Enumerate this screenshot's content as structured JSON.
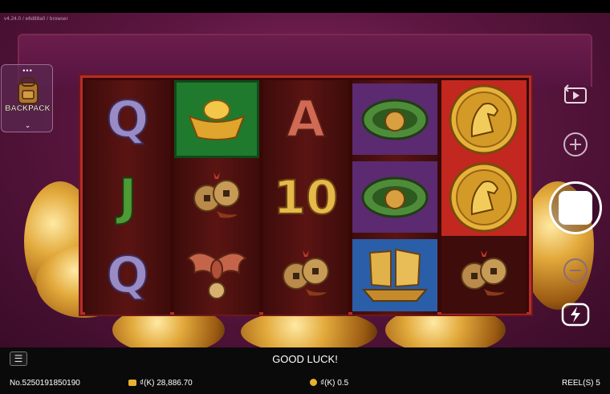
{
  "version": "v4.24.0 / e6d88a0 / browser",
  "backpack": {
    "label": "BACKPACK",
    "dots": "•••"
  },
  "reels": [
    {
      "cells": [
        {
          "symbol": "Q",
          "kind": "letter-q",
          "bg": ""
        },
        {
          "symbol": "J",
          "kind": "letter-j",
          "bg": ""
        },
        {
          "symbol": "Q",
          "kind": "letter-q",
          "bg": ""
        }
      ]
    },
    {
      "cells": [
        {
          "icon": "gold-ingot-icon",
          "bg": "bg-green"
        },
        {
          "icon": "chinese-coins-icon",
          "bg": ""
        },
        {
          "icon": "bat-icon",
          "bg": ""
        }
      ]
    },
    {
      "cells": [
        {
          "symbol": "A",
          "kind": "letter-a",
          "bg": ""
        },
        {
          "symbol": "10",
          "kind": "letter-10",
          "bg": ""
        },
        {
          "icon": "chinese-coins-icon",
          "bg": ""
        }
      ]
    },
    {
      "cells": [
        {
          "icon": "jade-ring-icon",
          "bg": "bg-purple"
        },
        {
          "icon": "jade-ring-icon",
          "bg": "bg-purple"
        },
        {
          "icon": "junk-ship-icon",
          "bg": "bg-blue"
        }
      ]
    },
    {
      "cells": [
        {
          "icon": "horse-coin-icon",
          "bg": "bg-red"
        },
        {
          "icon": "horse-coin-icon",
          "bg": "bg-red"
        },
        {
          "icon": "chinese-coins-icon",
          "bg": ""
        }
      ]
    }
  ],
  "colors": {
    "reel_border": "#b52d2a",
    "background": "#5c1640",
    "green_tile": "#1f7a2e",
    "red_tile": "#c2281f",
    "blue_tile": "#2a5ea8"
  },
  "status": {
    "message": "GOOD LUCK!",
    "ticket": "No.5250191850190",
    "balance": "₫(K) 28,886.70",
    "bet": "₫(K) 0.5",
    "reels": "REEL(S) 5"
  },
  "controls": {
    "autoplay_icon": "autoplay-icon",
    "bet_up_icon": "plus-icon",
    "spin_icon": "spin-stop-icon",
    "bet_down_icon": "minus-icon",
    "turbo_icon": "turbo-lightning-icon",
    "menu_icon": "menu-icon"
  }
}
